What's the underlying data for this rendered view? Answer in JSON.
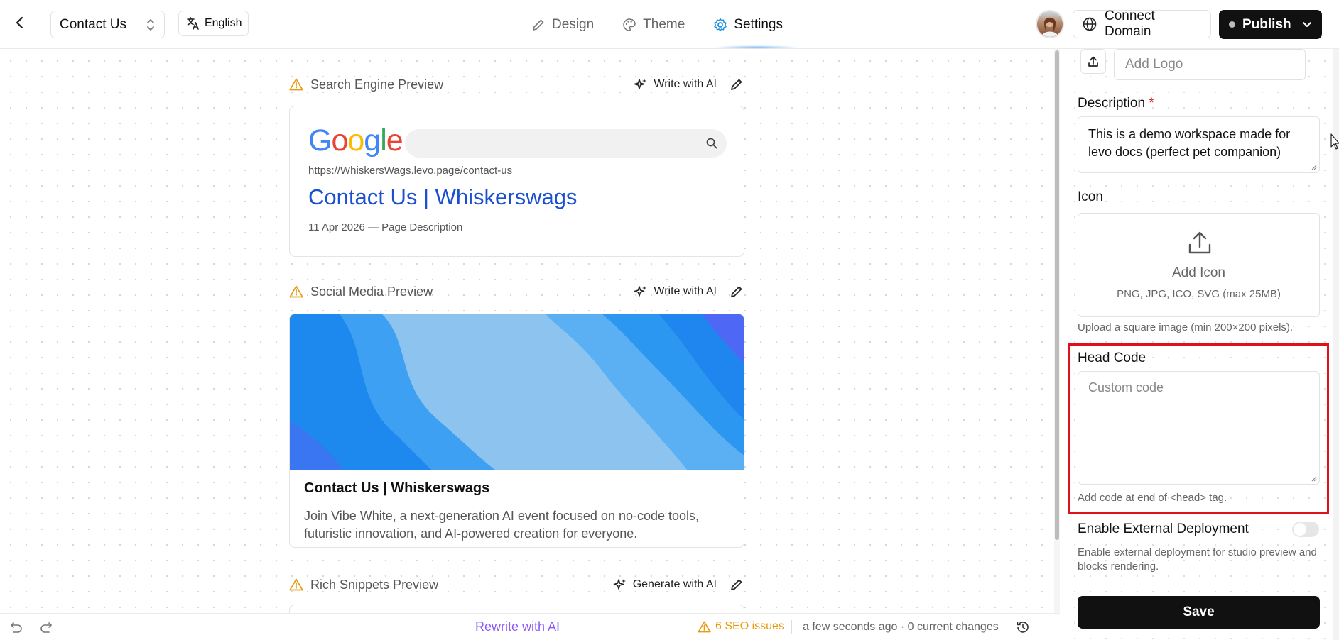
{
  "header": {
    "page_name": "Contact Us",
    "language": "English",
    "tabs": [
      {
        "label": "Design"
      },
      {
        "label": "Theme"
      },
      {
        "label": "Settings"
      }
    ],
    "connect_domain": "Connect Domain",
    "publish": "Publish"
  },
  "sections": {
    "search": {
      "title": "Search Engine Preview",
      "ai_label": "Write with AI"
    },
    "social": {
      "title": "Social Media Preview",
      "ai_label": "Write with AI"
    },
    "rich": {
      "title": "Rich Snippets Preview",
      "ai_label": "Generate with AI"
    }
  },
  "google_preview": {
    "logo": "Google",
    "url": "https://WhiskersWags.levo.page/contact-us",
    "title": "Contact Us | Whiskerswags",
    "meta": "11 Apr 2026 — Page Description"
  },
  "social_preview": {
    "title": "Contact Us | Whiskerswags",
    "description": "Join Vibe White, a next-generation AI event focused on no-code tools, futuristic innovation, and AI-powered creation for everyone."
  },
  "footer": {
    "rewrite": "Rewrite with AI",
    "seo_issues": "6 SEO issues",
    "saved_status": "a few seconds ago · 0 current changes"
  },
  "settings_panel": {
    "logo_placeholder": "Add Logo",
    "description_label": "Description",
    "description_required": "*",
    "description_value": "This is a demo workspace made for levo docs (perfect pet companion)",
    "icon_label": "Icon",
    "icon_upload_title": "Add Icon",
    "icon_upload_formats": "PNG, JPG, ICO, SVG (max 25MB)",
    "icon_hint": "Upload a square image (min 200×200 pixels).",
    "head_code_label": "Head Code",
    "head_code_placeholder": "Custom code",
    "head_code_hint": "Add code at end of <head> tag.",
    "external_label": "Enable External Deployment",
    "external_enabled": false,
    "external_hint": "Enable external deployment for studio preview and blocks rendering.",
    "save": "Save"
  },
  "colors": {
    "accent_settings": "#1a8fe0",
    "link_title": "#1a4fd0",
    "rewrite_purple": "#8b5cf6",
    "seo_orange": "#e89a10",
    "highlight_red": "#e0101a"
  }
}
